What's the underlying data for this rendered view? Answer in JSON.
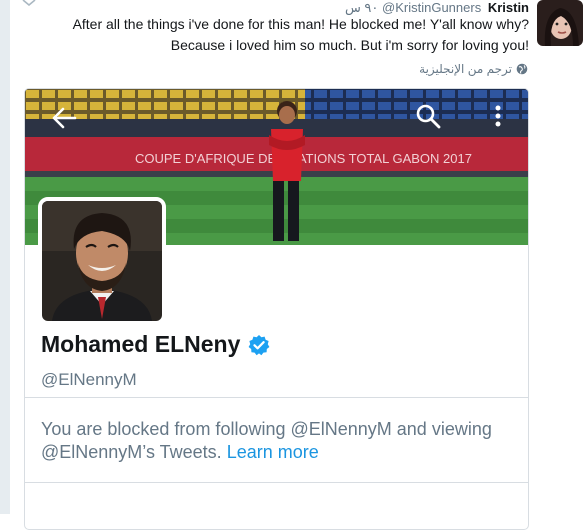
{
  "tweet": {
    "author_name": "Kristin",
    "author_handle": "@KristinGunners",
    "time": "٩٠ س",
    "text_line1": "After all the things i've done for this man! He blocked me! Y'all know why?",
    "text_line2": "Because i loved him so much. But i'm sorry for loving you!",
    "translate_label": "ترجم من الإنجليزية"
  },
  "profile_card": {
    "display_name": "Mohamed ELNeny",
    "handle": "@ElNennyM",
    "blocked_message": "You are blocked from following @ElNennyM and viewing @ElNennyM’s Tweets.",
    "learn_more_label": "Learn more",
    "banner_sign": "COUPE D'AFRIQUE DES NATIONS    TOTAL    GABON 2017"
  },
  "icons": {
    "back": "arrow-left-icon",
    "search": "search-icon",
    "more": "more-vertical-icon",
    "verified": "verified-badge-icon",
    "translate": "globe-icon"
  },
  "colors": {
    "verified_blue": "#1da1f2",
    "link_blue": "#1b95e0",
    "secondary_text": "#657786",
    "primary_text": "#14171a"
  }
}
